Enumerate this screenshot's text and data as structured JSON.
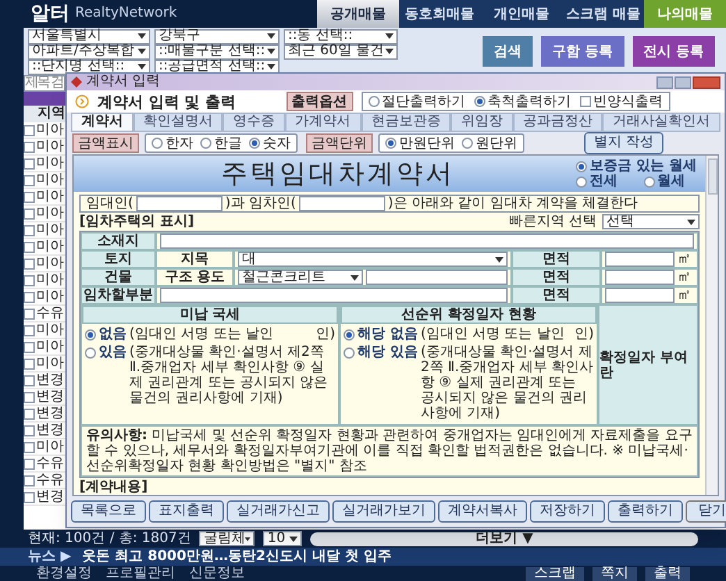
{
  "app": {
    "logo": "알터",
    "logo_sub": "RealtyNetwork",
    "nav": [
      {
        "label": "공개매물",
        "selected": true,
        "kind": "tab"
      },
      {
        "label": "동호회매물",
        "selected": false,
        "kind": "tab"
      },
      {
        "label": "개인매물",
        "selected": false,
        "kind": "tab"
      },
      {
        "label": "스크랩 매물",
        "selected": false,
        "kind": "tab"
      },
      {
        "label": "나의매물",
        "selected": false,
        "kind": "accent"
      }
    ],
    "filters": [
      "서울특별시",
      "강북구",
      "::동 선택::",
      "아파트/주상복합",
      "::매물구분 선택::",
      "최근 60일 물건",
      "::단지명 선택::",
      "::공급면적 선택::"
    ],
    "filter_buttons": [
      {
        "label": "검색",
        "color": "#4f7ea6"
      },
      {
        "label": "구함 등록",
        "color": "#6b6fc6"
      },
      {
        "label": "전시 등록",
        "color": "#8c3fa6"
      }
    ],
    "search_placeholder": "제목 검",
    "list": {
      "header": "지역",
      "rows": [
        {
          "text": "미아",
          "checked": false
        },
        {
          "text": "미아",
          "checked": false
        },
        {
          "text": "미아",
          "checked": false
        },
        {
          "text": "미아",
          "checked": false
        },
        {
          "text": "미아",
          "checked": false
        },
        {
          "text": "미아",
          "checked": false
        },
        {
          "text": "미아",
          "checked": false
        },
        {
          "text": "미아",
          "checked": false
        },
        {
          "text": "미아",
          "checked": false
        },
        {
          "text": "미아",
          "checked": false
        },
        {
          "text": "미아",
          "checked": false
        },
        {
          "text": "수유",
          "checked": false
        },
        {
          "text": "미아",
          "checked": false
        },
        {
          "text": "미아",
          "checked": false
        },
        {
          "text": "미아",
          "checked": false
        },
        {
          "text": "변경",
          "checked": false
        },
        {
          "text": "변경",
          "checked": false
        },
        {
          "text": "변경",
          "checked": false
        },
        {
          "text": "변경",
          "checked": false
        },
        {
          "text": "미아",
          "checked": false
        },
        {
          "text": "수유",
          "checked": false
        },
        {
          "text": "수유",
          "checked": false
        },
        {
          "text": "변경",
          "checked": false
        }
      ]
    },
    "status": {
      "count": "현재: 100건 / 총: 1807건",
      "font": "굴림체",
      "page_size": "10",
      "more": "더보기 ▼"
    },
    "news": {
      "label": "뉴스 ▶",
      "headline": "웃돈 최고 8000만원…동탄2신도시 내달 첫 입주"
    },
    "footer_left": [
      "환경설정",
      "프로필관리",
      "신문정보"
    ],
    "footer_right": [
      "스크랩",
      "쪽지",
      "출력"
    ]
  },
  "dialog": {
    "title": "계약서 입력",
    "heading": "계약서 입력 및 출력",
    "print_label": "출력옵션",
    "print_options": [
      {
        "label": "절단출력하기",
        "selected": false
      },
      {
        "label": "축척출력하기",
        "selected": true
      }
    ],
    "blank_form": {
      "label": "빈양식출력",
      "checked": false
    },
    "tabs": [
      {
        "label": "계약서",
        "selected": true
      },
      {
        "label": "확인설명서",
        "selected": false
      },
      {
        "label": "영수증",
        "selected": false
      },
      {
        "label": "가계약서",
        "selected": false
      },
      {
        "label": "현금보관증",
        "selected": false
      },
      {
        "label": "위임장",
        "selected": false
      },
      {
        "label": "공과금정산",
        "selected": false
      },
      {
        "label": "거래사실확인서",
        "selected": false
      }
    ],
    "amount_display": {
      "label": "금액표시",
      "options": [
        {
          "label": "한자",
          "selected": false
        },
        {
          "label": "한글",
          "selected": false
        },
        {
          "label": "숫자",
          "selected": true
        }
      ]
    },
    "amount_unit": {
      "label": "금액단위",
      "options": [
        {
          "label": "만원단위",
          "selected": true
        },
        {
          "label": "원단위",
          "selected": false
        }
      ]
    },
    "annex_button": "별지 작성",
    "doc": {
      "title": "주택임대차계약서",
      "lease_types": [
        {
          "label": "보증금 있는 월세",
          "selected": true
        },
        {
          "label": "전세",
          "selected": false
        },
        {
          "label": "월세",
          "selected": false
        }
      ],
      "party": [
        "임대인(",
        ")과 임차인(",
        ")은 아래와 같이 임대차 계약을 체결한다"
      ],
      "quick_region": {
        "label": "빠른지역 선택",
        "value": "선택"
      },
      "section": "[임차주택의 표시]",
      "location": "소재지",
      "land": {
        "label": "토지",
        "sub": "지목",
        "value": "대",
        "area": "면적",
        "unit": "㎡"
      },
      "building": {
        "label": "건물",
        "sub": "구조 용도",
        "value": "철근콘크리트",
        "area": "면적",
        "unit": "㎡"
      },
      "part": {
        "label": "임차할부분",
        "area": "면적",
        "unit": "㎡"
      },
      "tax": {
        "heading": "미납 국세",
        "options": [
          {
            "label": "없음",
            "note": "(임대인 서명 또는 날인",
            "seal": "인)",
            "selected": true
          },
          {
            "label": "있음",
            "note": "(중개대상물 확인·설명서 제2쪽 Ⅱ.중개업자 세부 확인사항 ⑨ 실제 권리관계 또는 공시되지 않은 물건의 권리사항에 기재)",
            "selected": false
          }
        ]
      },
      "priority": {
        "heading": "선순위 확정일자 현황",
        "options": [
          {
            "label": "해당 없음",
            "note": "(임대인 서명 또는 날인",
            "seal": "인)",
            "selected": true
          },
          {
            "label": "해당 있음",
            "note": "(중개대상물 확인·설명서 제2쪽 Ⅱ.중개업자 세부 확인사항 ⑨ 실제 권리관계 또는 공시되지 않은 물건의 권리사항에 기재)",
            "selected": false
          }
        ]
      },
      "stamp": "확정일자 부여란",
      "notice": {
        "label": "유의사항:",
        "text": "미납국세 및 선순위 확정일자 현황과 관련하여 중개업자는 임대인에게 자료제출을 요구할 수 있으나, 세무서와 확정일자부여기관에 이를 직접 확인할 법적권한은 없습니다. ※ 미납국세·선순위확정일자 현황 확인방법은 \"별지\" 참조"
      },
      "contract_section": "[계약내용]"
    },
    "left_buttons": [
      "목록으로",
      "표지출력",
      "실거래가신고",
      "실거래가보기"
    ],
    "right_buttons": [
      "계약서복사",
      "저장하기",
      "출력하기",
      "닫기"
    ]
  }
}
